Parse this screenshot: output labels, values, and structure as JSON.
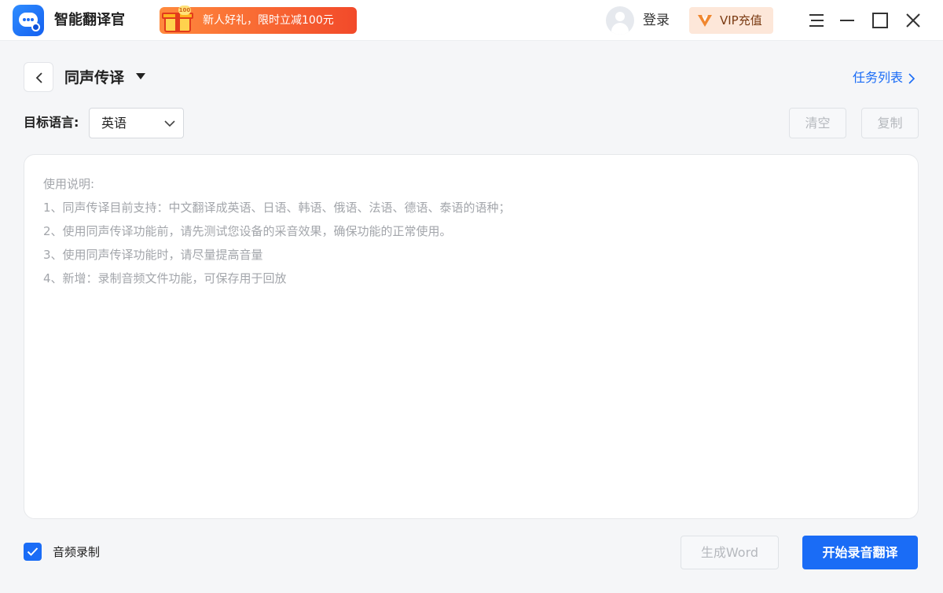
{
  "app": {
    "name": "智能翻译官",
    "logo_icon": "chat-bubble-icon",
    "accent_color": "#1a6cf6"
  },
  "promo": {
    "text": "新人好礼，限时立减100元",
    "coin_text": "100",
    "icon": "gift-box-icon"
  },
  "account": {
    "login_label": "登录",
    "vip_label": "VIP充值",
    "avatar_icon": "user-avatar-icon"
  },
  "window_controls": {
    "menu_icon": "hamburger-menu-icon",
    "minimize_icon": "minimize-icon",
    "maximize_icon": "maximize-icon",
    "close_icon": "close-icon"
  },
  "header": {
    "mode_title": "同声传译",
    "task_list_label": "任务列表"
  },
  "language": {
    "label": "目标语言:",
    "selected": "英语"
  },
  "actions": {
    "clear_label": "清空",
    "copy_label": "复制"
  },
  "instructions": {
    "lines": [
      "使用说明:",
      "1、同声传译目前支持：中文翻译成英语、日语、韩语、俄语、法语、德语、泰语的语种；",
      "2、使用同声传译功能前，请先测试您设备的采音效果，确保功能的正常使用。",
      "3、使用同声传译功能时，请尽量提高音量",
      "4、新增：录制音频文件功能，可保存用于回放"
    ]
  },
  "footer": {
    "audio_record_label": "音频录制",
    "audio_record_checked": true,
    "generate_word_label": "生成Word",
    "start_label": "开始录音翻译"
  }
}
